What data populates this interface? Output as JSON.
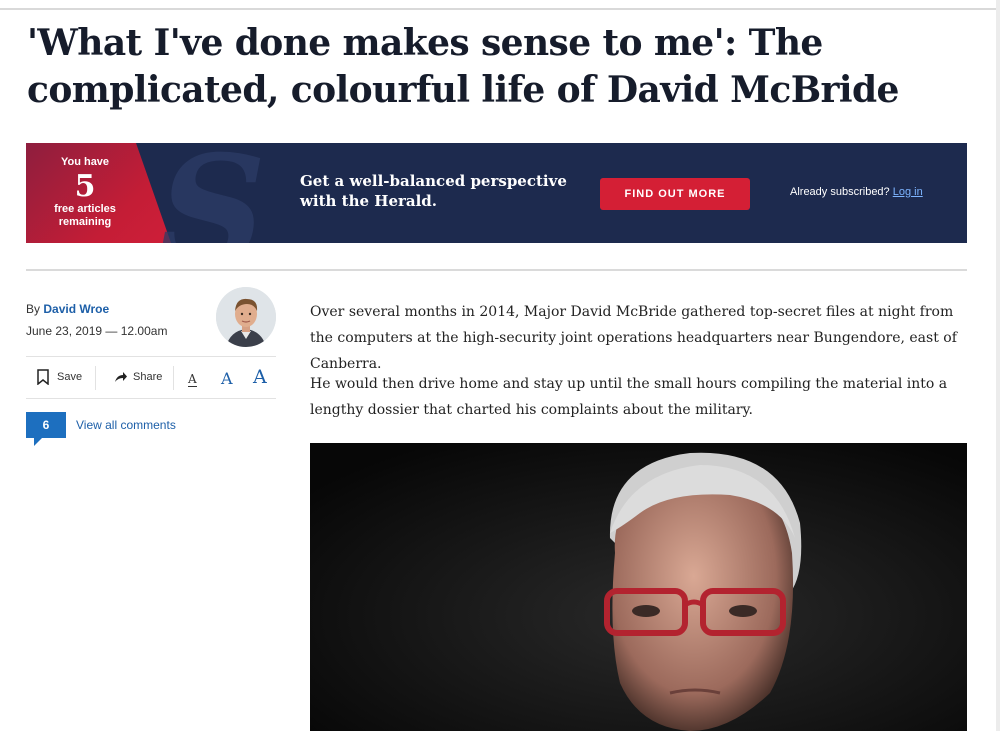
{
  "article": {
    "headline": "'What I've done makes sense to me': The complicated, colourful life of David McBride",
    "byline_prefix": "By",
    "author": "David Wroe",
    "date": "June 23, 2019 — 12.00am",
    "paragraphs": [
      "Over several months in 2014, Major David McBride gathered top-secret files at night from the computers at the high-security joint operations headquarters near Bungendore, east of Canberra.",
      "He would then drive home and stay up until the small hours compiling the material into a lengthy dossier that charted his complaints about the military."
    ]
  },
  "promo": {
    "you_have": "You have",
    "count": "5",
    "free_articles": "free articles",
    "remaining": "remaining",
    "logo_letter": "S",
    "message": "Get a well-balanced perspective with the Herald.",
    "cta": "FIND OUT MORE",
    "subscribed_text": "Already subscribed?",
    "login_link": "Log in"
  },
  "tools": {
    "save": "Save",
    "share": "Share",
    "font_small": "A",
    "font_medium": "A",
    "font_large": "A"
  },
  "comments": {
    "count": "6",
    "link": "View all comments"
  },
  "colors": {
    "navy": "#1d2a4e",
    "accent_red": "#d41f35",
    "link_blue": "#1d5fa8"
  },
  "icons": [
    "bookmark-icon",
    "share-arrow-icon",
    "comment-bubble-icon"
  ]
}
